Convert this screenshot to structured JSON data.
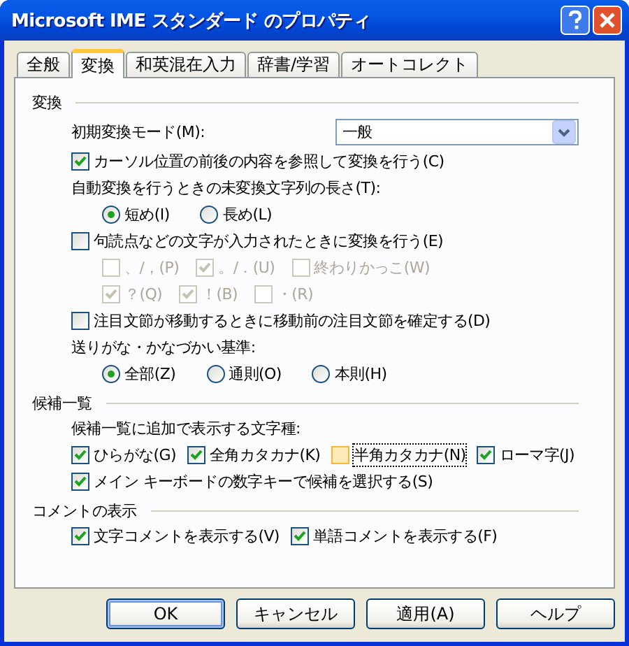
{
  "window": {
    "title": "Microsoft IME スタンダード のプロパティ"
  },
  "tabs": [
    {
      "label": "全般",
      "selected": false
    },
    {
      "label": "変換",
      "selected": true
    },
    {
      "label": "和英混在入力",
      "selected": false
    },
    {
      "label": "辞書/学習",
      "selected": false
    },
    {
      "label": "オートコレクト",
      "selected": false
    }
  ],
  "sections": [
    {
      "title": "変換",
      "rows": [
        {
          "kind": "select",
          "label": "初期変換モード(M):",
          "value": "一般"
        },
        {
          "kind": "checkbox",
          "label": "カーソル位置の前後の内容を参照して変換を行う(C)",
          "checked": true
        },
        {
          "kind": "label",
          "text": "自動変換を行うときの未変換文字列の長さ(T):"
        },
        {
          "kind": "radios",
          "options": [
            {
              "label": "短め(I)",
              "selected": true
            },
            {
              "label": "長め(L)",
              "selected": false
            }
          ]
        },
        {
          "kind": "checkbox",
          "label": "句読点などの文字が入力されたときに変換を行う(E)",
          "checked": false
        },
        {
          "kind": "subchecks",
          "items": [
            {
              "label": "、/，(P)",
              "checked": false,
              "disabled": true
            },
            {
              "label": "。/．(U)",
              "checked": true,
              "disabled": true
            },
            {
              "label": "終わりかっこ(W)",
              "checked": false,
              "disabled": true
            }
          ]
        },
        {
          "kind": "subchecks",
          "items": [
            {
              "label": "？(Q)",
              "checked": true,
              "disabled": true
            },
            {
              "label": "！(B)",
              "checked": true,
              "disabled": true
            },
            {
              "label": "・(R)",
              "checked": false,
              "disabled": true
            }
          ]
        },
        {
          "kind": "checkbox",
          "label": "注目文節が移動するときに移動前の注目文節を確定する(D)",
          "checked": false
        },
        {
          "kind": "label",
          "text": "送りがな・かなづかい基準:"
        },
        {
          "kind": "radios",
          "options": [
            {
              "label": "全部(Z)",
              "selected": true
            },
            {
              "label": "通則(O)",
              "selected": false
            },
            {
              "label": "本則(H)",
              "selected": false
            }
          ]
        }
      ]
    },
    {
      "title": "候補一覧",
      "rows": [
        {
          "kind": "label",
          "text": "候補一覧に追加で表示する文字種:"
        },
        {
          "kind": "checks",
          "items": [
            {
              "label": "ひらがな(G)",
              "checked": true,
              "focused": false
            },
            {
              "label": "全角カタカナ(K)",
              "checked": true,
              "focused": false
            },
            {
              "label": "半角カタカナ(N)",
              "checked": false,
              "focused": true
            },
            {
              "label": "ローマ字(J)",
              "checked": true,
              "focused": false
            }
          ]
        },
        {
          "kind": "checkbox",
          "label": "メイン キーボードの数字キーで候補を選択する(S)",
          "checked": true
        }
      ]
    },
    {
      "title": "コメントの表示",
      "rows": [
        {
          "kind": "checks",
          "items": [
            {
              "label": "文字コメントを表示する(V)",
              "checked": true,
              "focused": false
            },
            {
              "label": "単語コメントを表示する(F)",
              "checked": true,
              "focused": false
            }
          ]
        }
      ]
    }
  ],
  "buttons": [
    {
      "label": "OK",
      "default": true
    },
    {
      "label": "キャンセル",
      "default": false
    },
    {
      "label": "適用(A)",
      "default": false
    },
    {
      "label": "ヘルプ",
      "default": false
    }
  ]
}
